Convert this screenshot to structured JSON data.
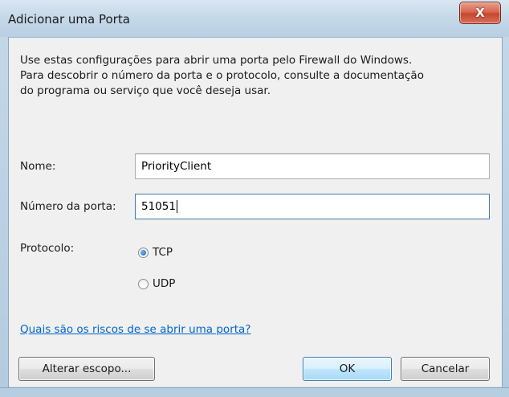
{
  "window": {
    "title": "Adicionar uma Porta",
    "close_label": "X"
  },
  "description": [
    "Use estas configurações para abrir uma porta pelo Firewall do Windows.",
    "Para descobrir o número da porta e o protocolo, consulte a documentação",
    "do programa ou serviço que você deseja usar."
  ],
  "form": {
    "name_label": "Nome:",
    "name_value": "PriorityClient",
    "port_label": "Número da porta:",
    "port_value": "51051",
    "protocol_label": "Protocolo:",
    "protocols": [
      {
        "label": "TCP",
        "checked": true
      },
      {
        "label": "UDP",
        "checked": false
      }
    ]
  },
  "risks_link": "Quais são os riscos de se abrir uma porta?",
  "buttons": {
    "change_scope": "Alterar escopo...",
    "ok": "OK",
    "cancel": "Cancelar"
  },
  "colors": {
    "link": "#0066cc",
    "close_button": "#c4482e"
  }
}
